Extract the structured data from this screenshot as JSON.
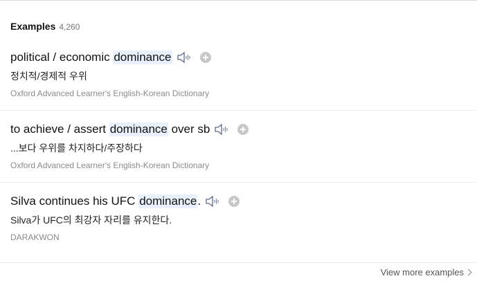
{
  "section": {
    "title": "Examples",
    "count": "4,260"
  },
  "examples": [
    {
      "before": "political / economic ",
      "keyword": "dominance",
      "after": "",
      "translation": "정치적/경제적 우위",
      "source": "Oxford Advanced Learner's English-Korean Dictionary"
    },
    {
      "before": "to achieve / assert ",
      "keyword": "dominance",
      "after": " over sb",
      "translation": "...보다 우위를 차지하다/주장하다",
      "source": "Oxford Advanced Learner's English-Korean Dictionary"
    },
    {
      "before": "Silva continues his UFC ",
      "keyword": "dominance",
      "after": ".",
      "translation": "Silva가 UFC의 최강자 자리를 유지한다.",
      "source": "DARAKWON"
    }
  ],
  "footer": {
    "view_more_label": "View more examples"
  },
  "icons": {
    "speaker": "speaker-icon",
    "add": "add-icon",
    "chevron": "chevron-right-icon"
  },
  "colors": {
    "highlight": "#e8f1fb",
    "speaker": "#5a6a8a",
    "add_button": "#c8c8c8"
  }
}
